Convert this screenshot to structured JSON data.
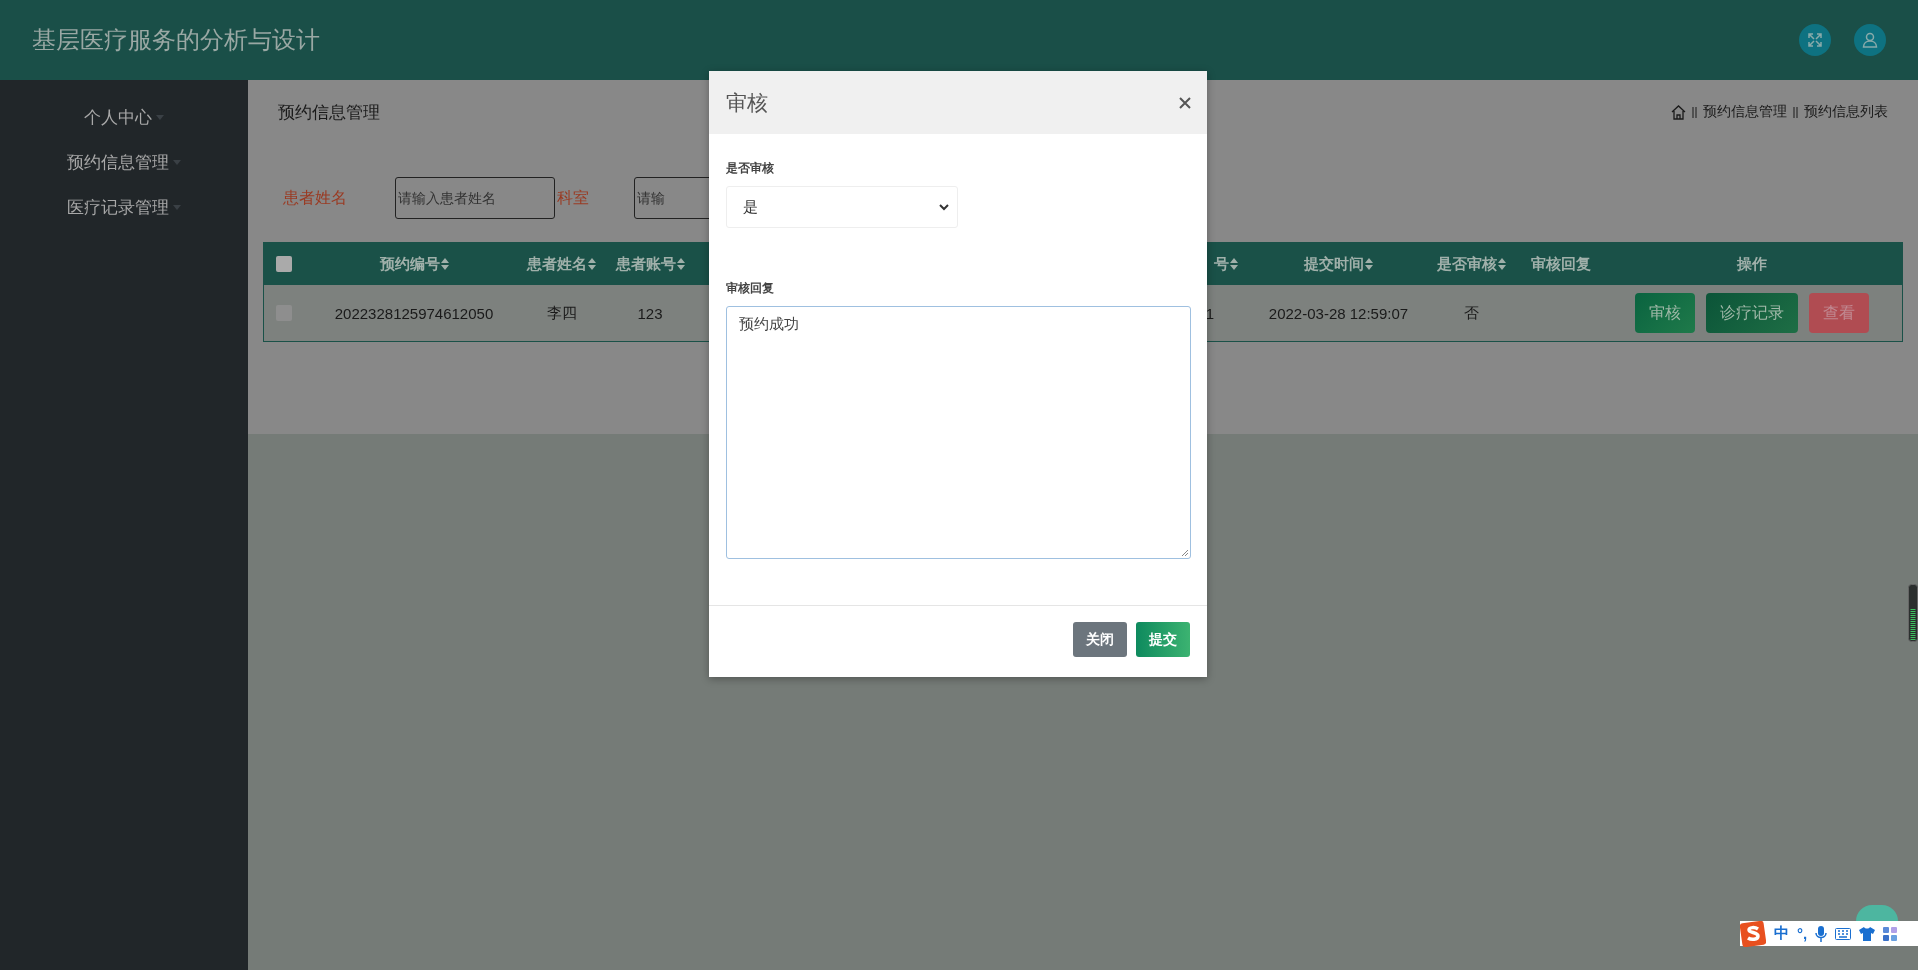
{
  "header": {
    "title": "基层医疗服务的分析与设计"
  },
  "sidebar": {
    "items": [
      {
        "label": "个人中心"
      },
      {
        "label": "预约信息管理"
      },
      {
        "label": "医疗记录管理"
      }
    ]
  },
  "page_title": "预约信息管理",
  "breadcrumb": [
    "预约信息管理",
    "预约信息列表"
  ],
  "search": [
    {
      "label": "患者姓名",
      "placeholder": "请输入患者姓名"
    },
    {
      "label": "科室",
      "placeholder": "请输"
    }
  ],
  "table": {
    "all_checked": false,
    "columns": [
      {
        "label": "预约编号",
        "sortable": true
      },
      {
        "label": "患者姓名",
        "sortable": true
      },
      {
        "label": "患者账号",
        "sortable": true
      },
      {},
      {
        "label": "号",
        "sortable": true
      },
      {
        "label": "提交时间",
        "sortable": true
      },
      {
        "label": "是否审核",
        "sortable": true
      },
      {
        "label": "审核回复",
        "sortable": false
      },
      {
        "label": "操作",
        "sortable": false
      }
    ],
    "rows": [
      {
        "checked": false,
        "cells": [
          "2022328125974612050",
          "李四",
          "123",
          null,
          "1",
          "2022-03-28 12:59:07",
          "否",
          null
        ],
        "actions": [
          {
            "label": "审核",
            "kind": "approve"
          },
          {
            "label": "诊疗记录",
            "kind": "records"
          },
          {
            "label": "查看",
            "kind": "view"
          }
        ]
      }
    ]
  },
  "modal": {
    "title": "审核",
    "fields": [
      {
        "label": "是否审核",
        "kind": "select",
        "value": "是"
      },
      {
        "label": "审核回复",
        "kind": "textarea",
        "value": "预约成功"
      }
    ],
    "buttons": [
      {
        "label": "关闭",
        "kind": "secondary"
      },
      {
        "label": "提交",
        "kind": "primary"
      }
    ]
  },
  "ime": {
    "mode": "中",
    "punct": "°,"
  }
}
